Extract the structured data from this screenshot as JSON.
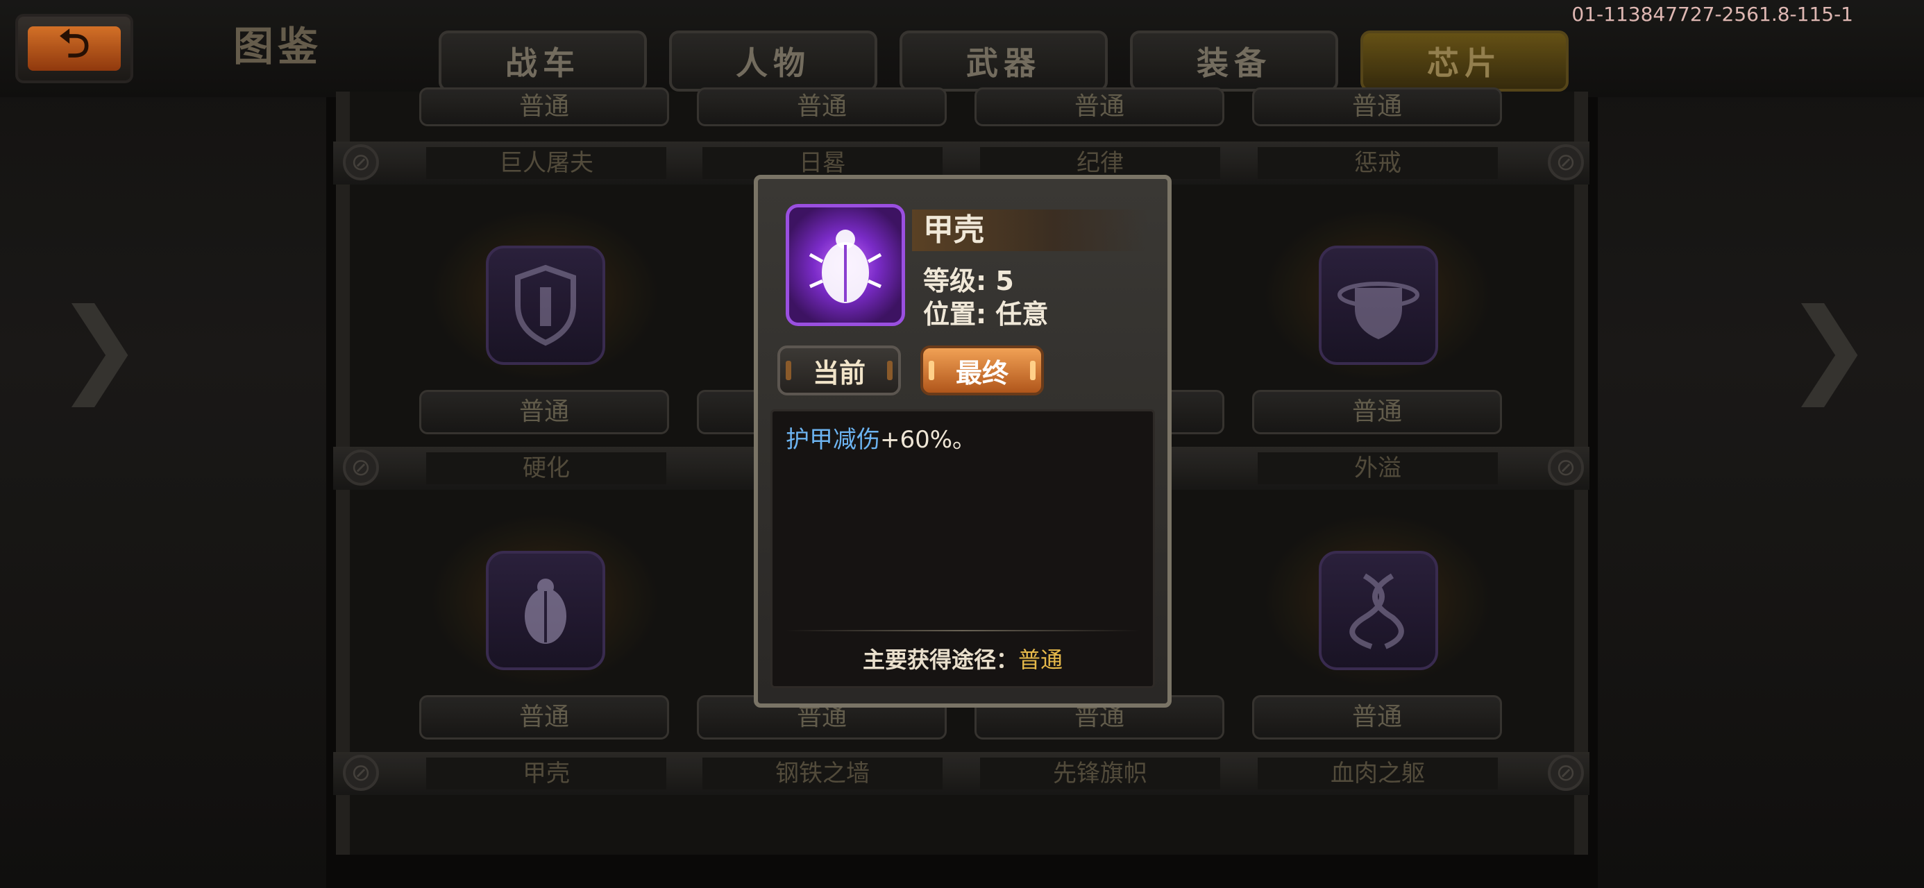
{
  "header": {
    "back_glyph": "⮌",
    "title": "图鉴",
    "build_id": "01-113847727-2561.8-115-1",
    "tabs": [
      {
        "label": "战车",
        "active": false
      },
      {
        "label": "人物",
        "active": false
      },
      {
        "label": "武器",
        "active": false
      },
      {
        "label": "装备",
        "active": false
      },
      {
        "label": "芯片",
        "active": true
      }
    ]
  },
  "grid": {
    "top_rarity": [
      "普通",
      "普通",
      "普通",
      "普通"
    ],
    "row1_names": [
      "巨人屠夫",
      "日晷",
      "纪律",
      "惩戒"
    ],
    "row2": {
      "rarity": [
        "普通",
        "",
        "",
        "普通"
      ],
      "names": [
        "硬化",
        "",
        "",
        "外溢"
      ],
      "icons": [
        "wrench-shield-icon",
        "",
        "",
        "shield-orbit-icon"
      ]
    },
    "row3": {
      "rarity": [
        "普通",
        "普通",
        "普通",
        "普通"
      ],
      "names": [
        "甲壳",
        "钢铁之墙",
        "先锋旗帜",
        "血肉之躯"
      ],
      "icons": [
        "beetle-icon",
        "",
        "",
        "dna-icon"
      ]
    }
  },
  "popup": {
    "name": "甲壳",
    "level_text": "等级: 5",
    "position_text": "位置: 任意",
    "btn_current": "当前",
    "btn_final": "最终",
    "desc_keyword": "护甲减伤",
    "desc_value": "+60%。",
    "source_label": "主要获得途径：",
    "source_value": "普通",
    "icon": "beetle-icon",
    "rarity_color": "#9a4fe0"
  },
  "colors": {
    "accent_gold": "#e6b94a",
    "keyword_blue": "#6cb3f0",
    "orange_button": "#d9762f"
  }
}
